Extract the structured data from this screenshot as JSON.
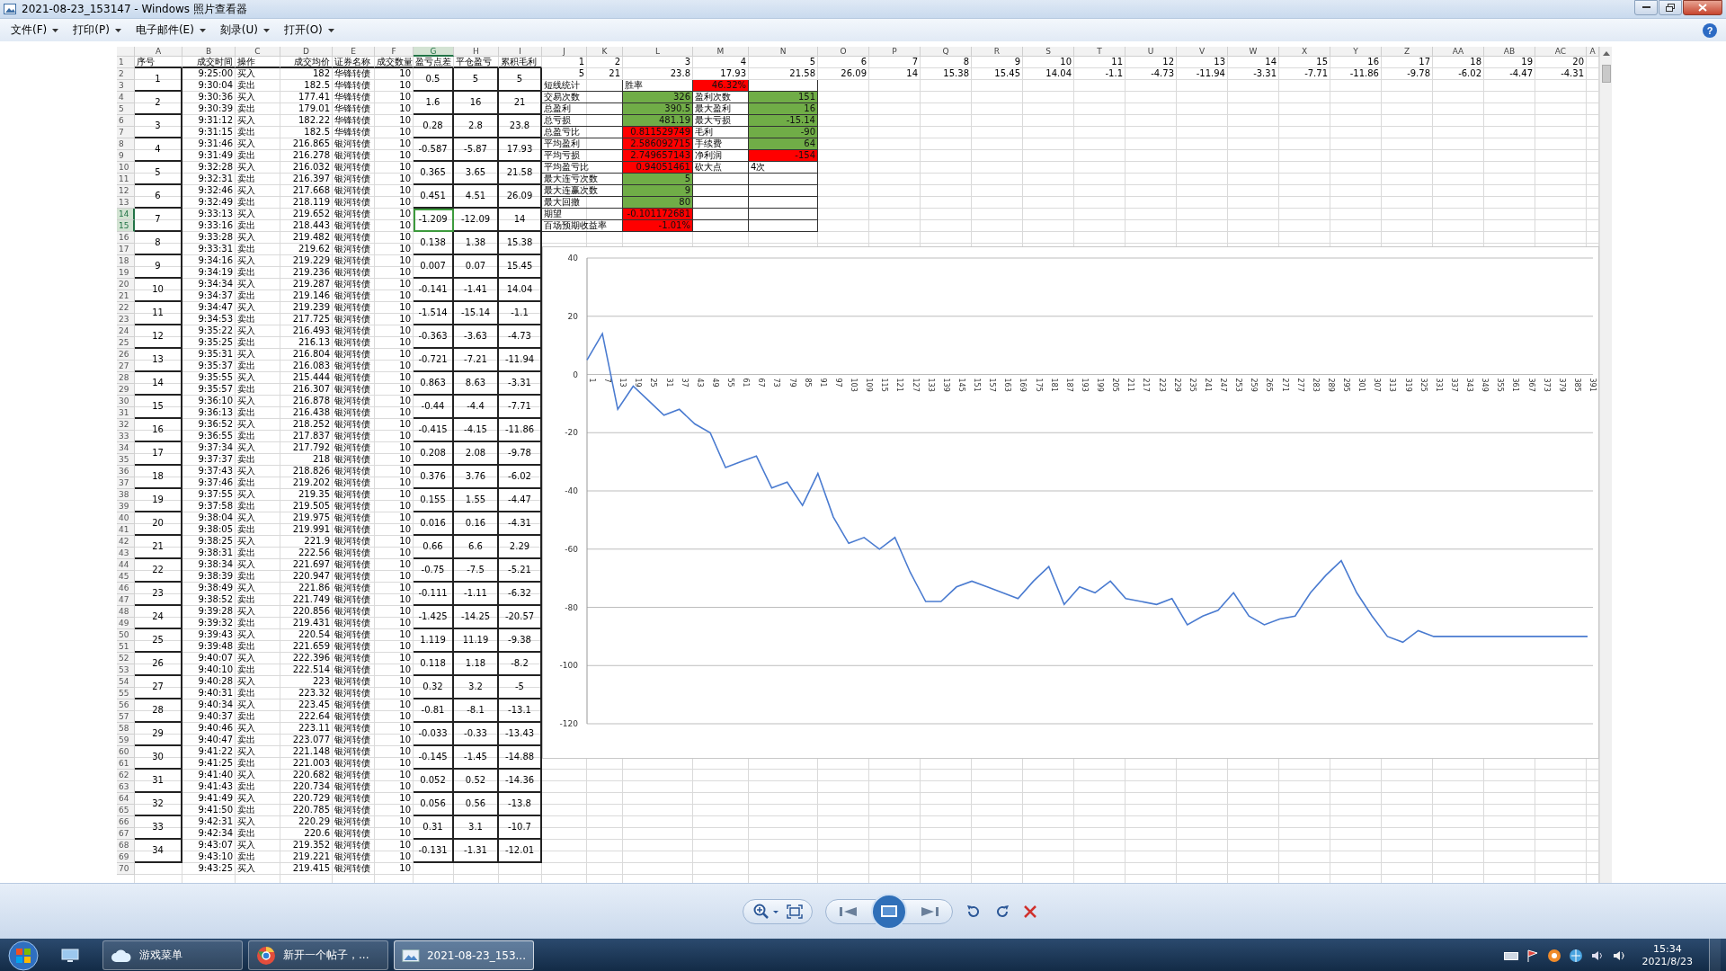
{
  "window": {
    "title": "2021-08-23_153147 - Windows 照片查看器"
  },
  "menu": [
    {
      "label": "文件(F)"
    },
    {
      "label": "打印(P)"
    },
    {
      "label": "电子邮件(E)"
    },
    {
      "label": "刻录(U)"
    },
    {
      "label": "打开(O)"
    }
  ],
  "help": "?",
  "sheet": {
    "columns": [
      {
        "label": "A",
        "selected": false
      },
      {
        "label": "B",
        "selected": false
      },
      {
        "label": "C",
        "selected": false
      },
      {
        "label": "D",
        "selected": false
      },
      {
        "label": "E",
        "selected": false
      },
      {
        "label": "F",
        "selected": false
      },
      {
        "label": "G",
        "selected": true
      },
      {
        "label": "H",
        "selected": false
      },
      {
        "label": "I",
        "selected": false
      },
      {
        "label": "J",
        "selected": false
      },
      {
        "label": "K",
        "selected": false
      },
      {
        "label": "L",
        "selected": false
      },
      {
        "label": "M",
        "selected": false
      },
      {
        "label": "N",
        "selected": false
      },
      {
        "label": "O",
        "selected": false
      },
      {
        "label": "P",
        "selected": false
      },
      {
        "label": "Q",
        "selected": false
      },
      {
        "label": "R",
        "selected": false
      },
      {
        "label": "S",
        "selected": false
      },
      {
        "label": "T",
        "selected": false
      },
      {
        "label": "U",
        "selected": false
      },
      {
        "label": "V",
        "selected": false
      },
      {
        "label": "W",
        "selected": false
      },
      {
        "label": "X",
        "selected": false
      },
      {
        "label": "Y",
        "selected": false
      },
      {
        "label": "Z",
        "selected": false
      },
      {
        "label": "AA",
        "selected": false
      },
      {
        "label": "AB",
        "selected": false
      },
      {
        "label": "AC",
        "selected": false
      },
      {
        "label": "A",
        "selected": false
      }
    ],
    "row_numbers": [
      "1",
      "2",
      "3",
      "4",
      "5",
      "6",
      "7",
      "8",
      "9",
      "10",
      "11",
      "12",
      "13",
      "14",
      "15",
      "16",
      "17",
      "18",
      "19",
      "20",
      "21",
      "22",
      "23",
      "24",
      "25",
      "26",
      "27",
      "28",
      "29",
      "30",
      "31",
      "32",
      "33",
      "34",
      "35",
      "36",
      "37",
      "38",
      "39",
      "40",
      "41",
      "42",
      "43",
      "44",
      "45",
      "46",
      "47",
      "48",
      "49",
      "50",
      "51",
      "52",
      "53",
      "54",
      "55",
      "56",
      "57",
      "58",
      "59",
      "60",
      "61",
      "62",
      "63",
      "64",
      "65",
      "66",
      "67",
      "68",
      "69",
      "70"
    ],
    "headers": [
      "序号",
      "成交时间",
      "操作",
      "成交均价",
      "证券名称",
      "成交数量",
      "盈亏点差",
      "平仓盈亏",
      "累积毛利"
    ],
    "trades": [
      {
        "no": "1",
        "selected": false,
        "legs": [
          [
            "9:25:00",
            "买入",
            "182",
            "华锋转债",
            "10"
          ],
          [
            "9:30:04",
            "卖出",
            "182.5",
            "华锋转债",
            "10"
          ]
        ],
        "diff": "0.5",
        "pnl": "5",
        "cum": "5"
      },
      {
        "no": "2",
        "selected": false,
        "legs": [
          [
            "9:30:36",
            "买入",
            "177.41",
            "华锋转债",
            "10"
          ],
          [
            "9:30:39",
            "卖出",
            "179.01",
            "华锋转债",
            "10"
          ]
        ],
        "diff": "1.6",
        "pnl": "16",
        "cum": "21"
      },
      {
        "no": "3",
        "selected": false,
        "legs": [
          [
            "9:31:12",
            "买入",
            "182.22",
            "华锋转债",
            "10"
          ],
          [
            "9:31:15",
            "卖出",
            "182.5",
            "华锋转债",
            "10"
          ]
        ],
        "diff": "0.28",
        "pnl": "2.8",
        "cum": "23.8"
      },
      {
        "no": "4",
        "selected": false,
        "legs": [
          [
            "9:31:46",
            "买入",
            "216.865",
            "银河转债",
            "10"
          ],
          [
            "9:31:49",
            "卖出",
            "216.278",
            "银河转债",
            "10"
          ]
        ],
        "diff": "-0.587",
        "pnl": "-5.87",
        "cum": "17.93"
      },
      {
        "no": "5",
        "selected": false,
        "legs": [
          [
            "9:32:28",
            "买入",
            "216.032",
            "银河转债",
            "10"
          ],
          [
            "9:32:31",
            "卖出",
            "216.397",
            "银河转债",
            "10"
          ]
        ],
        "diff": "0.365",
        "pnl": "3.65",
        "cum": "21.58"
      },
      {
        "no": "6",
        "selected": false,
        "legs": [
          [
            "9:32:46",
            "买入",
            "217.668",
            "银河转债",
            "10"
          ],
          [
            "9:32:49",
            "卖出",
            "218.119",
            "银河转债",
            "10"
          ]
        ],
        "diff": "0.451",
        "pnl": "4.51",
        "cum": "26.09"
      },
      {
        "no": "7",
        "selected": true,
        "legs": [
          [
            "9:33:13",
            "买入",
            "219.652",
            "银河转债",
            "10"
          ],
          [
            "9:33:16",
            "卖出",
            "218.443",
            "银河转债",
            "10"
          ]
        ],
        "diff": "-1.209",
        "pnl": "-12.09",
        "cum": "14"
      },
      {
        "no": "8",
        "selected": false,
        "legs": [
          [
            "9:33:28",
            "买入",
            "219.482",
            "银河转债",
            "10"
          ],
          [
            "9:33:31",
            "卖出",
            "219.62",
            "银河转债",
            "10"
          ]
        ],
        "diff": "0.138",
        "pnl": "1.38",
        "cum": "15.38"
      },
      {
        "no": "9",
        "selected": false,
        "legs": [
          [
            "9:34:16",
            "买入",
            "219.229",
            "银河转债",
            "10"
          ],
          [
            "9:34:19",
            "卖出",
            "219.236",
            "银河转债",
            "10"
          ]
        ],
        "diff": "0.007",
        "pnl": "0.07",
        "cum": "15.45"
      },
      {
        "no": "10",
        "selected": false,
        "legs": [
          [
            "9:34:34",
            "买入",
            "219.287",
            "银河转债",
            "10"
          ],
          [
            "9:34:37",
            "卖出",
            "219.146",
            "银河转债",
            "10"
          ]
        ],
        "diff": "-0.141",
        "pnl": "-1.41",
        "cum": "14.04"
      },
      {
        "no": "11",
        "selected": false,
        "legs": [
          [
            "9:34:47",
            "买入",
            "219.239",
            "银河转债",
            "10"
          ],
          [
            "9:34:53",
            "卖出",
            "217.725",
            "银河转债",
            "10"
          ]
        ],
        "diff": "-1.514",
        "pnl": "-15.14",
        "cum": "-1.1"
      },
      {
        "no": "12",
        "selected": false,
        "legs": [
          [
            "9:35:22",
            "买入",
            "216.493",
            "银河转债",
            "10"
          ],
          [
            "9:35:25",
            "卖出",
            "216.13",
            "银河转债",
            "10"
          ]
        ],
        "diff": "-0.363",
        "pnl": "-3.63",
        "cum": "-4.73"
      },
      {
        "no": "13",
        "selected": false,
        "legs": [
          [
            "9:35:31",
            "买入",
            "216.804",
            "银河转债",
            "10"
          ],
          [
            "9:35:37",
            "卖出",
            "216.083",
            "银河转债",
            "10"
          ]
        ],
        "diff": "-0.721",
        "pnl": "-7.21",
        "cum": "-11.94"
      },
      {
        "no": "14",
        "selected": false,
        "legs": [
          [
            "9:35:55",
            "买入",
            "215.444",
            "银河转债",
            "10"
          ],
          [
            "9:35:57",
            "卖出",
            "216.307",
            "银河转债",
            "10"
          ]
        ],
        "diff": "0.863",
        "pnl": "8.63",
        "cum": "-3.31"
      },
      {
        "no": "15",
        "selected": false,
        "legs": [
          [
            "9:36:10",
            "买入",
            "216.878",
            "银河转债",
            "10"
          ],
          [
            "9:36:13",
            "卖出",
            "216.438",
            "银河转债",
            "10"
          ]
        ],
        "diff": "-0.44",
        "pnl": "-4.4",
        "cum": "-7.71"
      },
      {
        "no": "16",
        "selected": false,
        "legs": [
          [
            "9:36:52",
            "买入",
            "218.252",
            "银河转债",
            "10"
          ],
          [
            "9:36:55",
            "卖出",
            "217.837",
            "银河转债",
            "10"
          ]
        ],
        "diff": "-0.415",
        "pnl": "-4.15",
        "cum": "-11.86"
      },
      {
        "no": "17",
        "selected": false,
        "legs": [
          [
            "9:37:34",
            "买入",
            "217.792",
            "银河转债",
            "10"
          ],
          [
            "9:37:37",
            "卖出",
            "218",
            "银河转债",
            "10"
          ]
        ],
        "diff": "0.208",
        "pnl": "2.08",
        "cum": "-9.78"
      },
      {
        "no": "18",
        "selected": false,
        "legs": [
          [
            "9:37:43",
            "买入",
            "218.826",
            "银河转债",
            "10"
          ],
          [
            "9:37:46",
            "卖出",
            "219.202",
            "银河转债",
            "10"
          ]
        ],
        "diff": "0.376",
        "pnl": "3.76",
        "cum": "-6.02"
      },
      {
        "no": "19",
        "selected": false,
        "legs": [
          [
            "9:37:55",
            "买入",
            "219.35",
            "银河转债",
            "10"
          ],
          [
            "9:37:58",
            "卖出",
            "219.505",
            "银河转债",
            "10"
          ]
        ],
        "diff": "0.155",
        "pnl": "1.55",
        "cum": "-4.47"
      },
      {
        "no": "20",
        "selected": false,
        "legs": [
          [
            "9:38:04",
            "买入",
            "219.975",
            "银河转债",
            "10"
          ],
          [
            "9:38:05",
            "卖出",
            "219.991",
            "银河转债",
            "10"
          ]
        ],
        "diff": "0.016",
        "pnl": "0.16",
        "cum": "-4.31"
      },
      {
        "no": "21",
        "selected": false,
        "legs": [
          [
            "9:38:25",
            "买入",
            "221.9",
            "银河转债",
            "10"
          ],
          [
            "9:38:31",
            "卖出",
            "222.56",
            "银河转债",
            "10"
          ]
        ],
        "diff": "0.66",
        "pnl": "6.6",
        "cum": "2.29"
      },
      {
        "no": "22",
        "selected": false,
        "legs": [
          [
            "9:38:34",
            "买入",
            "221.697",
            "银河转债",
            "10"
          ],
          [
            "9:38:39",
            "卖出",
            "220.947",
            "银河转债",
            "10"
          ]
        ],
        "diff": "-0.75",
        "pnl": "-7.5",
        "cum": "-5.21"
      },
      {
        "no": "23",
        "selected": false,
        "legs": [
          [
            "9:38:49",
            "买入",
            "221.86",
            "银河转债",
            "10"
          ],
          [
            "9:38:52",
            "卖出",
            "221.749",
            "银河转债",
            "10"
          ]
        ],
        "diff": "-0.111",
        "pnl": "-1.11",
        "cum": "-6.32"
      },
      {
        "no": "24",
        "selected": false,
        "legs": [
          [
            "9:39:28",
            "买入",
            "220.856",
            "银河转债",
            "10"
          ],
          [
            "9:39:32",
            "卖出",
            "219.431",
            "银河转债",
            "10"
          ]
        ],
        "diff": "-1.425",
        "pnl": "-14.25",
        "cum": "-20.57"
      },
      {
        "no": "25",
        "selected": false,
        "legs": [
          [
            "9:39:43",
            "买入",
            "220.54",
            "银河转债",
            "10"
          ],
          [
            "9:39:48",
            "卖出",
            "221.659",
            "银河转债",
            "10"
          ]
        ],
        "diff": "1.119",
        "pnl": "11.19",
        "cum": "-9.38"
      },
      {
        "no": "26",
        "selected": false,
        "legs": [
          [
            "9:40:07",
            "买入",
            "222.396",
            "银河转债",
            "10"
          ],
          [
            "9:40:10",
            "卖出",
            "222.514",
            "银河转债",
            "10"
          ]
        ],
        "diff": "0.118",
        "pnl": "1.18",
        "cum": "-8.2"
      },
      {
        "no": "27",
        "selected": false,
        "legs": [
          [
            "9:40:28",
            "买入",
            "223",
            "银河转债",
            "10"
          ],
          [
            "9:40:31",
            "卖出",
            "223.32",
            "银河转债",
            "10"
          ]
        ],
        "diff": "0.32",
        "pnl": "3.2",
        "cum": "-5"
      },
      {
        "no": "28",
        "selected": false,
        "legs": [
          [
            "9:40:34",
            "买入",
            "223.45",
            "银河转债",
            "10"
          ],
          [
            "9:40:37",
            "卖出",
            "222.64",
            "银河转债",
            "10"
          ]
        ],
        "diff": "-0.81",
        "pnl": "-8.1",
        "cum": "-13.1"
      },
      {
        "no": "29",
        "selected": false,
        "legs": [
          [
            "9:40:46",
            "买入",
            "223.11",
            "银河转债",
            "10"
          ],
          [
            "9:40:47",
            "卖出",
            "223.077",
            "银河转债",
            "10"
          ]
        ],
        "diff": "-0.033",
        "pnl": "-0.33",
        "cum": "-13.43"
      },
      {
        "no": "30",
        "selected": false,
        "legs": [
          [
            "9:41:22",
            "买入",
            "221.148",
            "银河转债",
            "10"
          ],
          [
            "9:41:25",
            "卖出",
            "221.003",
            "银河转债",
            "10"
          ]
        ],
        "diff": "-0.145",
        "pnl": "-1.45",
        "cum": "-14.88"
      },
      {
        "no": "31",
        "selected": false,
        "legs": [
          [
            "9:41:40",
            "买入",
            "220.682",
            "银河转债",
            "10"
          ],
          [
            "9:41:43",
            "卖出",
            "220.734",
            "银河转债",
            "10"
          ]
        ],
        "diff": "0.052",
        "pnl": "0.52",
        "cum": "-14.36"
      },
      {
        "no": "32",
        "selected": false,
        "legs": [
          [
            "9:41:49",
            "买入",
            "220.729",
            "银河转债",
            "10"
          ],
          [
            "9:41:50",
            "卖出",
            "220.785",
            "银河转债",
            "10"
          ]
        ],
        "diff": "0.056",
        "pnl": "0.56",
        "cum": "-13.8"
      },
      {
        "no": "33",
        "selected": false,
        "legs": [
          [
            "9:42:31",
            "买入",
            "220.29",
            "银河转债",
            "10"
          ],
          [
            "9:42:34",
            "卖出",
            "220.6",
            "银河转债",
            "10"
          ]
        ],
        "diff": "0.31",
        "pnl": "3.1",
        "cum": "-10.7"
      },
      {
        "no": "34",
        "selected": false,
        "legs": [
          [
            "9:43:07",
            "买入",
            "219.352",
            "银河转债",
            "10"
          ],
          [
            "9:43:10",
            "卖出",
            "219.221",
            "银河转债",
            "10"
          ]
        ],
        "diff": "-0.131",
        "pnl": "-1.31",
        "cum": "-12.01"
      }
    ],
    "partial_leg": [
      "9:43:25",
      "买入",
      "219.415",
      "银河转债",
      "10"
    ],
    "row_1": [
      "1",
      "2",
      "3",
      "4",
      "5",
      "6",
      "7",
      "8",
      "9",
      "10",
      "11",
      "12",
      "13",
      "14",
      "15",
      "16",
      "17",
      "18",
      "19",
      "20"
    ],
    "row_2": [
      "5",
      "21",
      "23.8",
      "17.93",
      "21.58",
      "26.09",
      "14",
      "15.38",
      "15.45",
      "14.04",
      "-1.1",
      "-4.73",
      "-11.94",
      "-3.31",
      "-7.71",
      "-11.86",
      "-9.78",
      "-6.02",
      "-4.47",
      "-4.31"
    ],
    "stats": [
      {
        "cells": [
          {
            "kind": "label",
            "text": "短线统计"
          },
          {
            "kind": "label",
            "text": "胜率"
          },
          {
            "kind": "number",
            "text": "46.32%",
            "color": "#ff0000"
          },
          {
            "kind": "empty"
          }
        ]
      },
      {
        "cells": [
          {
            "kind": "label",
            "text": "交易次数"
          },
          {
            "kind": "number",
            "text": "326",
            "color": "#70ad47"
          },
          {
            "kind": "label",
            "text": "盈利次数"
          },
          {
            "kind": "number",
            "text": "151",
            "color": "#70ad47"
          }
        ]
      },
      {
        "cells": [
          {
            "kind": "label",
            "text": "总盈利"
          },
          {
            "kind": "number",
            "text": "390.5",
            "color": "#70ad47"
          },
          {
            "kind": "label",
            "text": "最大盈利"
          },
          {
            "kind": "number",
            "text": "16",
            "color": "#70ad47"
          }
        ]
      },
      {
        "cells": [
          {
            "kind": "label",
            "text": "总亏损"
          },
          {
            "kind": "number",
            "text": "481.19",
            "color": "#70ad47"
          },
          {
            "kind": "label",
            "text": "最大亏损"
          },
          {
            "kind": "number",
            "text": "-15.14",
            "color": "#70ad47"
          }
        ]
      },
      {
        "cells": [
          {
            "kind": "label",
            "text": "总盈亏比"
          },
          {
            "kind": "number",
            "text": "0.811529749",
            "color": "#ff0000"
          },
          {
            "kind": "label",
            "text": "毛利"
          },
          {
            "kind": "number",
            "text": "-90",
            "color": "#70ad47"
          }
        ]
      },
      {
        "cells": [
          {
            "kind": "label",
            "text": "平均盈利"
          },
          {
            "kind": "number",
            "text": "2.586092715",
            "color": "#ff0000"
          },
          {
            "kind": "label",
            "text": "手续费"
          },
          {
            "kind": "number",
            "text": "64",
            "color": "#70ad47"
          }
        ]
      },
      {
        "cells": [
          {
            "kind": "label",
            "text": "平均亏损"
          },
          {
            "kind": "number",
            "text": "2.749657143",
            "color": "#ff0000"
          },
          {
            "kind": "label",
            "text": "净利润"
          },
          {
            "kind": "number",
            "text": "-154",
            "color": "#ff0000"
          }
        ]
      },
      {
        "cells": [
          {
            "kind": "label",
            "text": "平均盈亏比"
          },
          {
            "kind": "number",
            "text": "0.94051461",
            "color": "#ff0000"
          },
          {
            "kind": "label",
            "text": "砍大点"
          },
          {
            "kind": "label",
            "text": "4次"
          }
        ]
      },
      {
        "cells": [
          {
            "kind": "label",
            "text": "最大连亏次数"
          },
          {
            "kind": "number",
            "text": "5",
            "color": "#70ad47"
          },
          {
            "kind": "empty"
          },
          {
            "kind": "empty"
          }
        ]
      },
      {
        "cells": [
          {
            "kind": "label",
            "text": "最大连赢次数"
          },
          {
            "kind": "number",
            "text": "9",
            "color": "#70ad47"
          },
          {
            "kind": "empty"
          },
          {
            "kind": "empty"
          }
        ]
      },
      {
        "cells": [
          {
            "kind": "label",
            "text": "最大回撤"
          },
          {
            "kind": "number",
            "text": "80",
            "color": "#70ad47"
          },
          {
            "kind": "empty"
          },
          {
            "kind": "empty"
          }
        ]
      },
      {
        "cells": [
          {
            "kind": "label",
            "text": "期望"
          },
          {
            "kind": "number",
            "text": "-0.101172681",
            "color": "#ff0000"
          },
          {
            "kind": "empty"
          },
          {
            "kind": "empty"
          }
        ]
      },
      {
        "cells": [
          {
            "kind": "label",
            "text": "百场预期收益率"
          },
          {
            "kind": "number",
            "text": "-1.01%",
            "color": "#ff0000"
          },
          {
            "kind": "empty"
          },
          {
            "kind": "empty"
          }
        ]
      }
    ],
    "chart_data": {
      "type": "line",
      "grid": true,
      "categories": [
        "1",
        "7",
        "13",
        "19",
        "25",
        "31",
        "37",
        "43",
        "49",
        "55",
        "61",
        "67",
        "73",
        "79",
        "85",
        "91",
        "97",
        "103",
        "109",
        "115",
        "121",
        "127",
        "133",
        "139",
        "145",
        "151",
        "157",
        "163",
        "169",
        "175",
        "181",
        "187",
        "193",
        "199",
        "205",
        "211",
        "217",
        "223",
        "229",
        "235",
        "241",
        "247",
        "253",
        "259",
        "265",
        "271",
        "277",
        "283",
        "289",
        "295",
        "301",
        "307",
        "313",
        "319",
        "325",
        "331",
        "337",
        "343",
        "349",
        "355",
        "361",
        "367",
        "373",
        "379",
        "385",
        "391"
      ],
      "series": [
        {
          "color": "#4a7bd0",
          "values": [
            5,
            14,
            -12,
            -4,
            -9,
            -14,
            -12,
            -17,
            -20,
            -32,
            -30,
            -28,
            -39,
            -37,
            -45,
            -34,
            -49,
            -58,
            -56,
            -60,
            -56,
            -68,
            -78,
            -78,
            -73,
            -71,
            -73,
            -75,
            -77,
            -71,
            -66,
            -79,
            -73,
            -75,
            -71,
            -77,
            -78,
            -79,
            -77,
            -86,
            -83,
            -81,
            -75,
            -83,
            -86,
            -84,
            -83,
            -75,
            -69,
            -64,
            -75,
            -83,
            -90,
            -92,
            -88,
            -90,
            -90,
            -90,
            -90,
            -90,
            -90,
            -90,
            -90,
            -90,
            -90,
            -90
          ]
        }
      ],
      "ylim": [
        -120,
        40
      ],
      "yticks": [
        -120,
        -100,
        -80,
        -60,
        -40,
        -20,
        0,
        20,
        40
      ]
    }
  },
  "taskbar": {
    "tasks": [
      {
        "label": "游戏菜单",
        "selected": false,
        "kind": "cloud"
      },
      {
        "label": "新开一个帖子，...",
        "selected": false,
        "kind": "browser"
      },
      {
        "label": "2021-08-23_153...",
        "selected": true,
        "kind": "photo"
      }
    ],
    "time": "15:34",
    "date": "2021/8/23"
  }
}
